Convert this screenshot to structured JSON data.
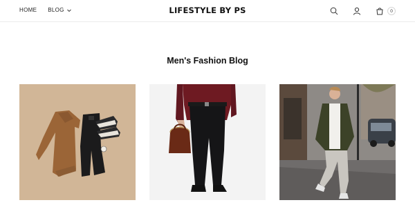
{
  "header": {
    "nav": [
      {
        "label": "HOME"
      },
      {
        "label": "BLOG"
      }
    ],
    "logo": "LIFESTYLE BY PS",
    "cart_count": "0"
  },
  "main": {
    "title": "Men's Fashion Blog",
    "cards": [
      {
        "image": "flat-lay-outfit-image",
        "alt": "Sweater, jeans and sneakers flat lay"
      },
      {
        "image": "man-with-bag-image",
        "alt": "Man in burgundy shirt holding a leather bag"
      },
      {
        "image": "street-style-image",
        "alt": "Man walking on city street"
      }
    ]
  },
  "colors": {
    "accent": "#111111",
    "border": "#ececec"
  }
}
